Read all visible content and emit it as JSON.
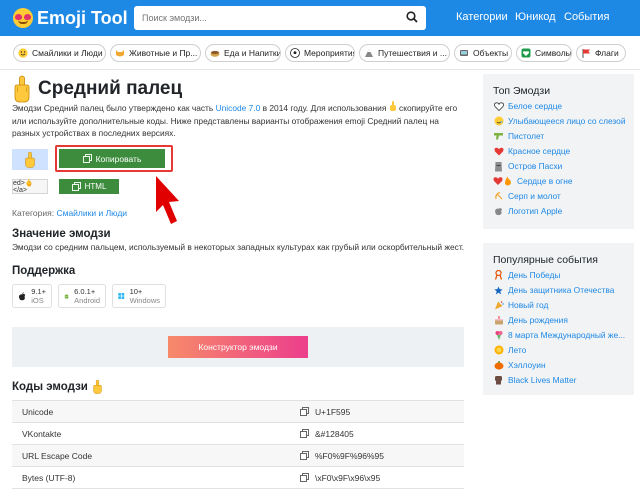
{
  "header": {
    "logo_text": "Emoji Tool",
    "search_placeholder": "Поиск эмодзи...",
    "nav": [
      "Категории",
      "Юникод",
      "События"
    ]
  },
  "categories": [
    {
      "label": "Смайлики и Люди",
      "icon": "smiley-icon"
    },
    {
      "label": "Животные и Пр...",
      "icon": "cat-icon"
    },
    {
      "label": "Еда и Напитки",
      "icon": "food-icon"
    },
    {
      "label": "Мероприятия",
      "icon": "soccer-ball-icon"
    },
    {
      "label": "Путешествия и ...",
      "icon": "travel-icon"
    },
    {
      "label": "Объекты",
      "icon": "objects-icon"
    },
    {
      "label": "Символы",
      "icon": "heart-symbol-icon"
    },
    {
      "label": "Флаги",
      "icon": "flag-icon"
    }
  ],
  "main": {
    "title": "Средний палец",
    "desc_1": "Эмодзи Средний палец было утверждено как часть ",
    "desc_link": "Unicode 7.0",
    "desc_2": " в 2014 году. Для использования ",
    "desc_3": " скопируйте его или используйте дополнительные коды. Ниже представлены варианты отображения emoji Средний палец на разных устройствах в последних версиях.",
    "copy_label": "Копировать",
    "code_preview": "ed>🖕</a>",
    "html_label": "HTML",
    "category_label": "Категория: ",
    "category_value": "Смайлики и Люди",
    "meaning_heading": "Значение эмодзи",
    "meaning_text": "Эмодзи со средним пальцем, используемый в некоторых западных культурах как грубый или оскорбительный жест.",
    "support_heading": "Поддержка",
    "platforms": [
      {
        "version": "9.1+",
        "name": "iOS",
        "icon": "apple-icon"
      },
      {
        "version": "6.0.1+",
        "name": "Android",
        "icon": "android-icon"
      },
      {
        "version": "10+",
        "name": "Windows",
        "icon": "windows-icon"
      }
    ],
    "constructor_label": "Конструктор эмодзи",
    "codes_heading": "Коды эмодзи",
    "codes": [
      {
        "key": "Unicode",
        "value": "U+1F595"
      },
      {
        "key": "VKontakte",
        "value": "&#128405"
      },
      {
        "key": "URL Escape Code",
        "value": "%F0%9F%96%95"
      },
      {
        "key": "Bytes (UTF-8)",
        "value": "\\xF0\\x9F\\x96\\x95"
      }
    ]
  },
  "sidebar_top": {
    "heading": "Топ Эмодзи",
    "items": [
      {
        "label": "Белое сердце",
        "icon": "white-heart-icon"
      },
      {
        "label": "Улыбающееся лицо со слезой",
        "icon": "smiling-tear-icon"
      },
      {
        "label": "Пистолет",
        "icon": "pistol-icon"
      },
      {
        "label": "Красное сердце",
        "icon": "red-heart-icon"
      },
      {
        "label": "Остров Пасхи",
        "icon": "moai-icon"
      },
      {
        "label": "Сердце в огне",
        "icon": "heart-on-fire-icon"
      },
      {
        "label": "Серп и молот",
        "icon": "hammer-sickle-icon"
      },
      {
        "label": "Логотип Apple",
        "icon": "apple-logo-icon"
      }
    ]
  },
  "sidebar_events": {
    "heading": "Популярные события",
    "items": [
      {
        "label": "День Победы",
        "icon": "ribbon-icon"
      },
      {
        "label": "День защитника Отечества",
        "icon": "star-icon"
      },
      {
        "label": "Новый год",
        "icon": "party-icon"
      },
      {
        "label": "День рождения",
        "icon": "cake-icon"
      },
      {
        "label": "8 марта Международный же...",
        "icon": "bouquet-icon"
      },
      {
        "label": "Лето",
        "icon": "sun-icon"
      },
      {
        "label": "Хэллоуин",
        "icon": "pumpkin-icon"
      },
      {
        "label": "Black Lives Matter",
        "icon": "fist-icon"
      }
    ]
  }
}
